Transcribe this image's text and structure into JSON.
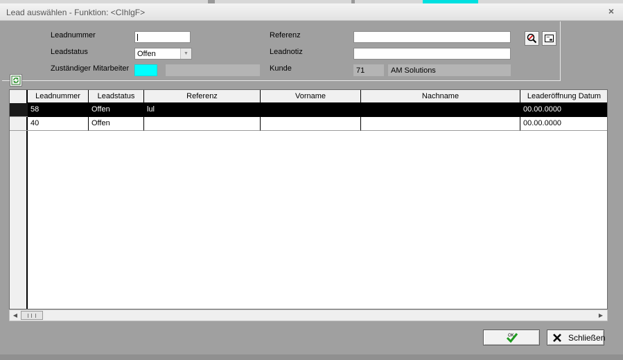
{
  "window": {
    "title": "Lead auswählen - Funktion: <CIhlgF>",
    "close_label": "×"
  },
  "filter": {
    "leadnummer_label": "Leadnummer",
    "leadnummer_value": "",
    "leadstatus_label": "Leadstatus",
    "leadstatus_value": "Offen",
    "mitarbeiter_label": "Zuständiger Mitarbeiter",
    "mitarbeiter_code": "",
    "mitarbeiter_name": "",
    "referenz_label": "Referenz",
    "referenz_value": "",
    "leadnotiz_label": "Leadnotiz",
    "leadnotiz_value": "",
    "kunde_label": "Kunde",
    "kunde_id": "71",
    "kunde_name": "AM Solutions"
  },
  "colors": {
    "selected_row_bg": "#000000",
    "mitarbeiter_field": "#00ffff",
    "window_bg": "#a0a0a0"
  },
  "icons": {
    "refresh": "refresh-icon",
    "search": "search-icon",
    "card": "card-icon",
    "ok": "checkmark-icon",
    "close": "x-icon"
  },
  "grid": {
    "columns": [
      "Leadnummer",
      "Leadstatus",
      "Referenz",
      "Vorname",
      "Nachname",
      "Leaderöffnung Datum"
    ],
    "rows": [
      {
        "leadnummer": "58",
        "leadstatus": "Offen",
        "referenz": "lul",
        "vorname": "",
        "nachname": "",
        "datum": "00.00.0000",
        "selected": true
      },
      {
        "leadnummer": "40",
        "leadstatus": "Offen",
        "referenz": "",
        "vorname": "",
        "nachname": "",
        "datum": "00.00.0000",
        "selected": false
      }
    ]
  },
  "buttons": {
    "ok_label": "OK",
    "close_label": "Schließen"
  }
}
